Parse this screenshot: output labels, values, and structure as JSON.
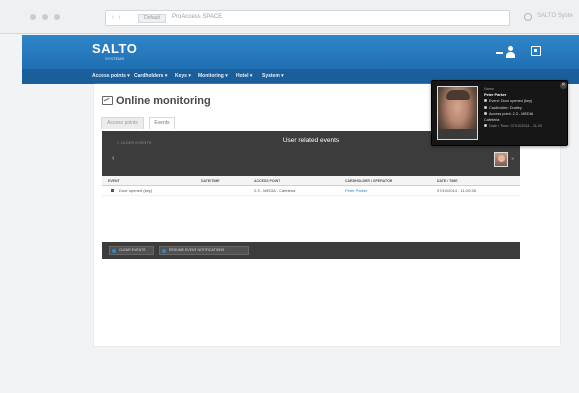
{
  "browser": {
    "address_chip": "Default",
    "url_text": "ProAccess SPACE",
    "window_title": "SALTO Syste"
  },
  "header": {
    "logo": "SALTO",
    "logo_subtitle": "SYSTEMS",
    "accent_color": "#1f6fb2"
  },
  "nav": {
    "items": [
      "Access points ▾",
      "Cardholders ▾",
      "Keys ▾",
      "Monitoring ▾",
      "Hotel ▾",
      "System ▾"
    ]
  },
  "page": {
    "title": "Online monitoring",
    "tabs": [
      "Access points",
      "Events"
    ]
  },
  "events_strip": {
    "left_label": "< OLDER EVENTS",
    "center_label": "User related events"
  },
  "table": {
    "headers": [
      "EVENT",
      "DATE/TIME",
      "ACCESS POINT",
      "CARDHOLDER / OPERATOR",
      "DATE / TIME"
    ],
    "rows": [
      {
        "event": "Door opened (key)",
        "access_point": "2.3 - MEDIA - Cafeteria",
        "user": "Peter Parker",
        "datetime": "07/10/2014 - 11:20:38"
      }
    ]
  },
  "actions": {
    "clear_label": "CLEAR EVENTS",
    "resume_label": "RESUME EVENT NOTIFICATIONS"
  },
  "popup": {
    "name_caption": "Name",
    "name": "Peter Parker",
    "lines": [
      "Event: Door opened (key)",
      "Cardholder: Dudley",
      "Access point: 2.3 - MEDIA",
      "Cafeteria",
      "Date / Time: 07/10/2014 - 11:20"
    ]
  }
}
